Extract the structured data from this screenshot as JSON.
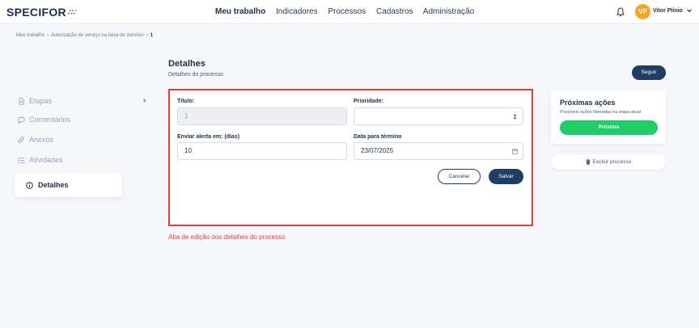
{
  "app": {
    "logo": "SPECIFOR"
  },
  "nav": {
    "items": [
      {
        "label": "Meu trabalho",
        "active": true
      },
      {
        "label": "Indicadores",
        "active": false
      },
      {
        "label": "Processos",
        "active": false
      },
      {
        "label": "Cadastros",
        "active": false
      },
      {
        "label": "Administração",
        "active": false
      }
    ]
  },
  "user": {
    "initials": "VP",
    "name": "Vitor Plinio",
    "avatar_color": "#f5a623"
  },
  "breadcrumb": {
    "items": [
      "Meu trabalho",
      "Autorização de serviço na faixa de domínio",
      "1"
    ]
  },
  "header": {
    "title": "Detalhes",
    "subtitle": "Detalhes do processo",
    "follow_label": "Seguir"
  },
  "sidebar": {
    "items": [
      {
        "label": "Etapas",
        "icon": "file-icon"
      },
      {
        "label": "Comentários",
        "icon": "comment-icon"
      },
      {
        "label": "Anexos",
        "icon": "paperclip-icon"
      },
      {
        "label": "Atividades",
        "icon": "list-icon"
      }
    ],
    "active": {
      "label": "Detalhes",
      "icon": "info-icon"
    }
  },
  "form": {
    "title_label": "Título:",
    "title_value": "1",
    "priority_label": "Prioridade:",
    "priority_value": "",
    "alert_label": "Enviar alerta em: (dias)",
    "alert_value": "10",
    "due_label": "Data para término",
    "due_value": "23/07/2025",
    "cancel_label": "Cancelar",
    "save_label": "Salvar"
  },
  "annotation": {
    "text": "Aba de edição dos detalhes do processo",
    "color": "#e53b3b"
  },
  "next_actions": {
    "title": "Próximas ações",
    "subtitle": "Possíveis ações liberadas na etapa atual",
    "button_label": "Próximo",
    "button_color": "#1fce6a"
  },
  "delete": {
    "label": "Excluir processo"
  },
  "colors": {
    "primary": "#1f3e63",
    "accent_green": "#1fce6a",
    "highlight_red": "#e53b3b"
  }
}
